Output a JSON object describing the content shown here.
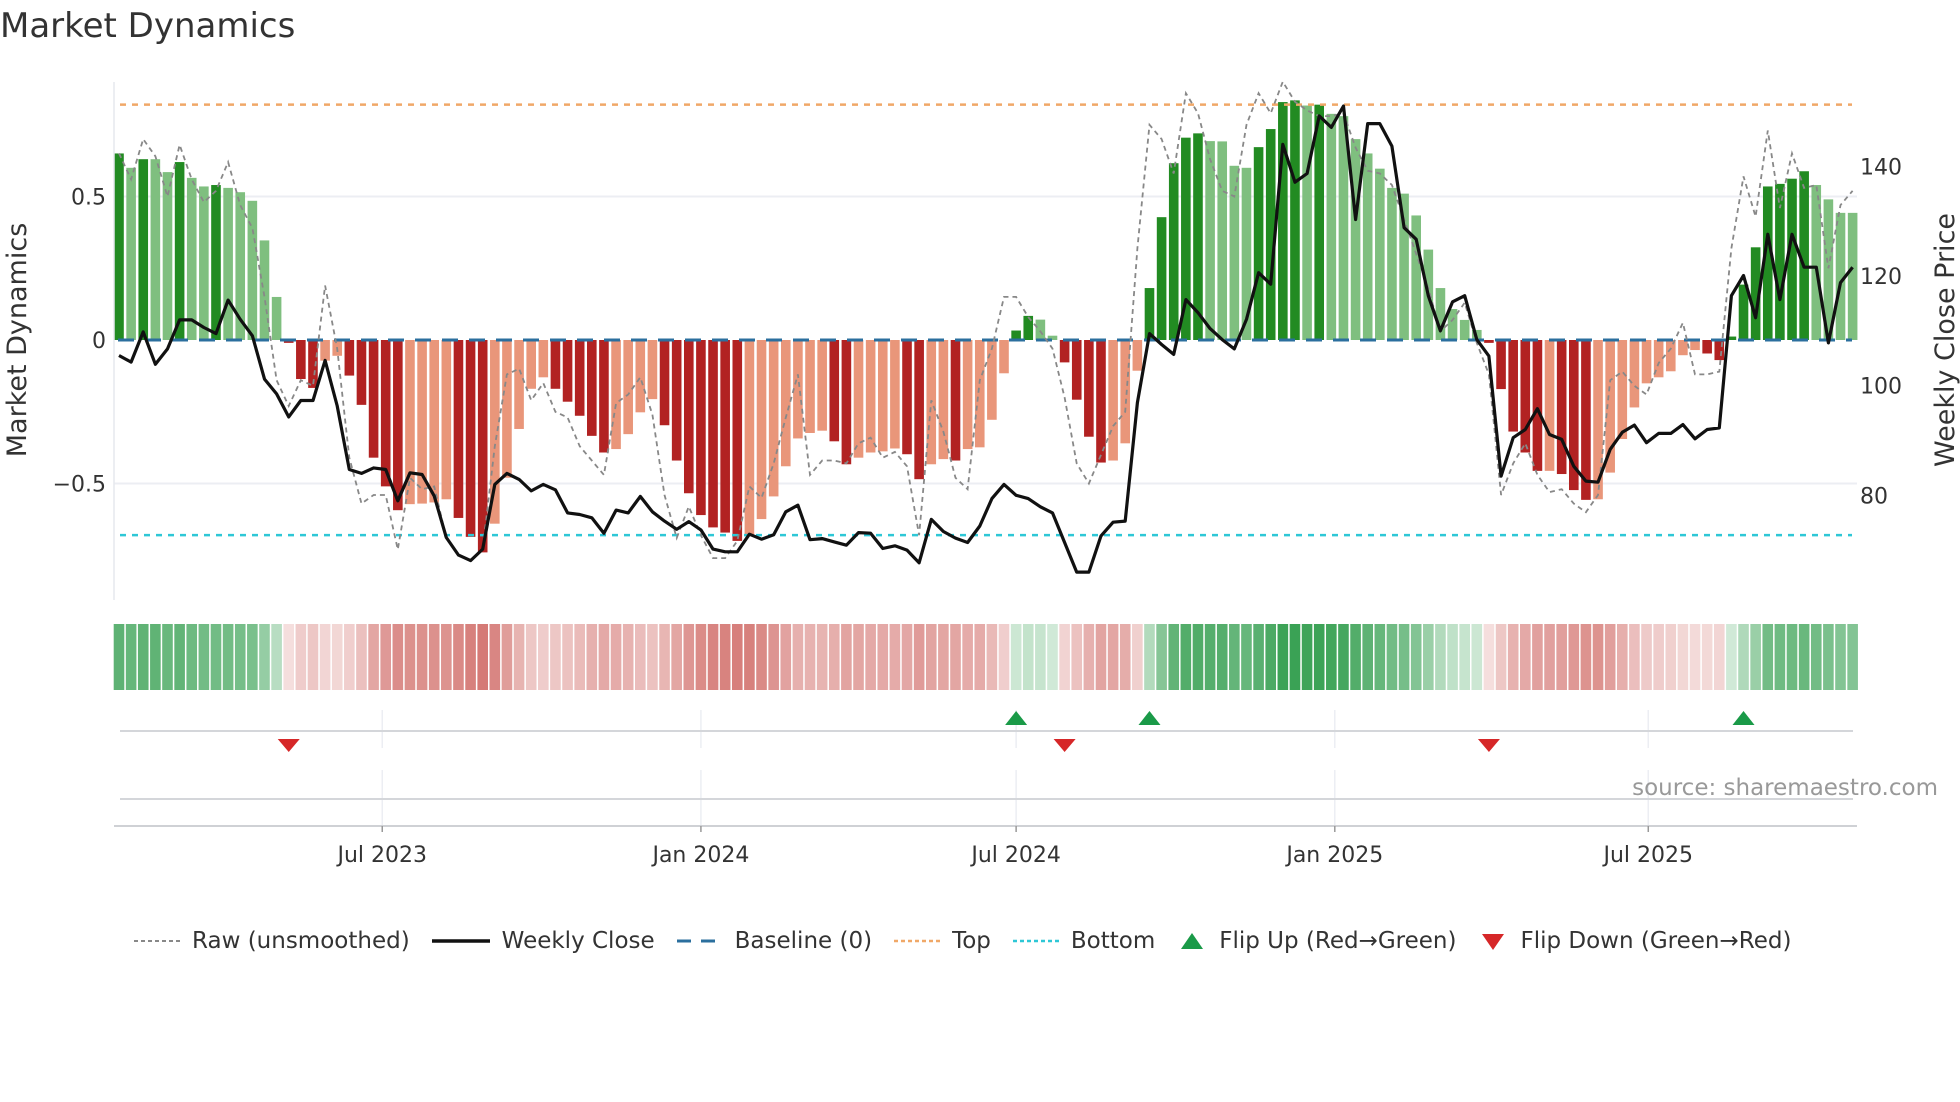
{
  "chart_data": {
    "type": "bar",
    "title": "Market Dynamics",
    "ylabel": "Market Dynamics",
    "y2label": "Weekly Close Price",
    "ylim": [
      -0.92,
      0.98
    ],
    "y2lim": [
      62,
      159
    ],
    "yticks": [
      {
        "v": 0.5,
        "label": "0.5"
      },
      {
        "v": 0,
        "label": "0"
      },
      {
        "v": -0.5,
        "label": "−0.5"
      }
    ],
    "y2ticks": [
      {
        "v": 140,
        "label": "140"
      },
      {
        "v": 120,
        "label": "120"
      },
      {
        "v": 100,
        "label": "100"
      },
      {
        "v": 80,
        "label": "80"
      }
    ],
    "xticks": [
      {
        "date": "2023-07-01",
        "label": "Jul 2023"
      },
      {
        "date": "2024-01-01",
        "label": "Jan 2024"
      },
      {
        "date": "2024-07-01",
        "label": "Jul 2024"
      },
      {
        "date": "2025-01-01",
        "label": "Jan 2025"
      },
      {
        "date": "2025-07-01",
        "label": "Jul 2025"
      }
    ],
    "start_week": "2023-01-30",
    "frequency": "weekly",
    "top_level": 0.82,
    "bottom_level": -0.68,
    "baseline": 0,
    "dynamics": [
      0.65,
      0.6,
      0.63,
      0.63,
      0.585,
      0.62,
      0.565,
      0.535,
      0.54,
      0.53,
      0.515,
      0.485,
      0.347,
      0.15,
      -0.01,
      -0.136,
      -0.167,
      -0.072,
      -0.055,
      -0.124,
      -0.226,
      -0.41,
      -0.51,
      -0.593,
      -0.572,
      -0.57,
      -0.566,
      -0.555,
      -0.62,
      -0.686,
      -0.74,
      -0.64,
      -0.48,
      -0.31,
      -0.17,
      -0.13,
      -0.17,
      -0.215,
      -0.264,
      -0.334,
      -0.392,
      -0.38,
      -0.328,
      -0.252,
      -0.206,
      -0.297,
      -0.42,
      -0.534,
      -0.61,
      -0.653,
      -0.671,
      -0.7,
      -0.677,
      -0.624,
      -0.545,
      -0.44,
      -0.343,
      -0.324,
      -0.316,
      -0.353,
      -0.433,
      -0.41,
      -0.392,
      -0.388,
      -0.378,
      -0.398,
      -0.485,
      -0.433,
      -0.415,
      -0.42,
      -0.38,
      -0.374,
      -0.278,
      -0.116,
      0.033,
      0.084,
      0.071,
      0.015,
      -0.078,
      -0.208,
      -0.337,
      -0.427,
      -0.42,
      -0.36,
      -0.107,
      0.181,
      0.428,
      0.616,
      0.705,
      0.72,
      0.693,
      0.692,
      0.607,
      0.6,
      0.672,
      0.735,
      0.829,
      0.835,
      0.817,
      0.82,
      0.788,
      0.78,
      0.7,
      0.65,
      0.597,
      0.53,
      0.51,
      0.434,
      0.315,
      0.181,
      0.108,
      0.07,
      0.035,
      -0.01,
      -0.171,
      -0.319,
      -0.392,
      -0.456,
      -0.456,
      -0.467,
      -0.523,
      -0.557,
      -0.555,
      -0.462,
      -0.345,
      -0.235,
      -0.151,
      -0.13,
      -0.109,
      -0.053,
      -0.035,
      -0.047,
      -0.07,
      0.012,
      0.193,
      0.323,
      0.535,
      0.544,
      0.562,
      0.588,
      0.54,
      0.49,
      0.443,
      0.443
    ],
    "raw": [
      0.65,
      0.56,
      0.7,
      0.64,
      0.5,
      0.68,
      0.56,
      0.48,
      0.52,
      0.62,
      0.47,
      0.39,
      0.15,
      -0.14,
      -0.23,
      -0.14,
      -0.16,
      0.19,
      -0.03,
      -0.41,
      -0.57,
      -0.54,
      -0.54,
      -0.73,
      -0.48,
      -0.52,
      -0.51,
      -0.69,
      -0.75,
      -0.77,
      -0.73,
      -0.37,
      -0.12,
      -0.1,
      -0.21,
      -0.15,
      -0.25,
      -0.27,
      -0.37,
      -0.42,
      -0.47,
      -0.22,
      -0.19,
      -0.13,
      -0.26,
      -0.54,
      -0.69,
      -0.58,
      -0.68,
      -0.76,
      -0.76,
      -0.7,
      -0.51,
      -0.55,
      -0.43,
      -0.27,
      -0.12,
      -0.47,
      -0.42,
      -0.42,
      -0.43,
      -0.36,
      -0.34,
      -0.41,
      -0.39,
      -0.44,
      -0.68,
      -0.21,
      -0.32,
      -0.48,
      -0.52,
      -0.14,
      -0.03,
      0.15,
      0.15,
      0.08,
      0.03,
      -0.03,
      -0.2,
      -0.43,
      -0.5,
      -0.4,
      -0.3,
      -0.25,
      0.32,
      0.75,
      0.7,
      0.58,
      0.86,
      0.79,
      0.63,
      0.52,
      0.5,
      0.75,
      0.86,
      0.79,
      0.9,
      0.83,
      0.8,
      0.78,
      0.78,
      0.79,
      0.67,
      0.59,
      0.58,
      0.54,
      0.42,
      0.3,
      0.18,
      0.03,
      0.07,
      0.13,
      -0.01,
      -0.12,
      -0.54,
      -0.43,
      -0.36,
      -0.47,
      -0.53,
      -0.52,
      -0.57,
      -0.6,
      -0.54,
      -0.14,
      -0.11,
      -0.16,
      -0.19,
      -0.08,
      -0.03,
      0.06,
      -0.12,
      -0.12,
      -0.11,
      0.32,
      0.57,
      0.43,
      0.73,
      0.46,
      0.65,
      0.53,
      0.54,
      0.25,
      0.47,
      0.52
    ],
    "close": [
      105.5,
      104.3,
      109.8,
      103.9,
      106.7,
      112.0,
      112.0,
      110.6,
      109.5,
      115.6,
      112.1,
      109.1,
      101.2,
      98.5,
      94.3,
      97.3,
      97.3,
      104.6,
      96.3,
      84.7,
      84.0,
      85.0,
      84.7,
      79.0,
      84.1,
      83.8,
      79.9,
      72.3,
      69.1,
      68.1,
      70.2,
      82.0,
      84.0,
      82.9,
      80.8,
      82.0,
      81.0,
      76.8,
      76.5,
      75.9,
      73.1,
      77.3,
      76.8,
      79.8,
      77.0,
      75.3,
      73.8,
      75.2,
      73.7,
      70.2,
      69.7,
      69.7,
      72.9,
      72.0,
      72.8,
      77.0,
      78.2,
      71.9,
      72.1,
      71.5,
      70.9,
      73.2,
      73.1,
      70.3,
      70.8,
      70.0,
      67.7,
      75.6,
      73.4,
      72.2,
      71.4,
      74.4,
      79.4,
      82.0,
      80.0,
      79.4,
      77.9,
      76.8,
      71.4,
      66.0,
      66.0,
      72.6,
      75.1,
      75.3,
      96.9,
      109.5,
      107.5,
      105.7,
      115.7,
      113.3,
      110.4,
      108.4,
      106.7,
      112.1,
      120.6,
      118.5,
      144.0,
      137.1,
      138.7,
      149.2,
      147.1,
      151.0,
      130.3,
      147.8,
      147.8,
      143.7,
      128.8,
      126.7,
      116.4,
      110.0,
      115.3,
      116.4,
      108.4,
      105.4,
      83.5,
      90.5,
      92.0,
      95.8,
      91.1,
      90.2,
      85.3,
      82.6,
      82.4,
      88.4,
      91.5,
      92.8,
      89.6,
      91.3,
      91.3,
      92.9,
      90.3,
      92.0,
      92.3,
      116.4,
      120.1,
      112.4,
      127.6,
      115.7,
      127.6,
      121.6,
      121.6,
      107.8,
      118.8,
      121.6
    ],
    "flips": [
      {
        "week_index": 14,
        "dir": "down"
      },
      {
        "week_index": 74,
        "dir": "up"
      },
      {
        "week_index": 78,
        "dir": "down"
      },
      {
        "week_index": 85,
        "dir": "up"
      },
      {
        "week_index": 113,
        "dir": "down"
      },
      {
        "week_index": 134,
        "dir": "up"
      }
    ],
    "legend": {
      "position": "bottom",
      "raw": "Raw (unsmoothed)",
      "close": "Weekly Close",
      "baseline": "Baseline (0)",
      "top": "Top",
      "bottom": "Bottom",
      "flip_up": "Flip Up (Red→Green)",
      "flip_down": "Flip Down (Green→Red)"
    },
    "source": "source: sharemaestro.com"
  },
  "colors": {
    "green_strong": "#228b22",
    "green_weak": "#7fbf7f",
    "red_strong": "#b22222",
    "red_weak": "#e9967a",
    "baseline": "#2b6f9e",
    "top": "#f0a868",
    "bottom": "#2ec7d6",
    "raw": "#888888",
    "close": "#111111",
    "flip_up": "#1a9a48",
    "flip_down": "#d62728"
  }
}
